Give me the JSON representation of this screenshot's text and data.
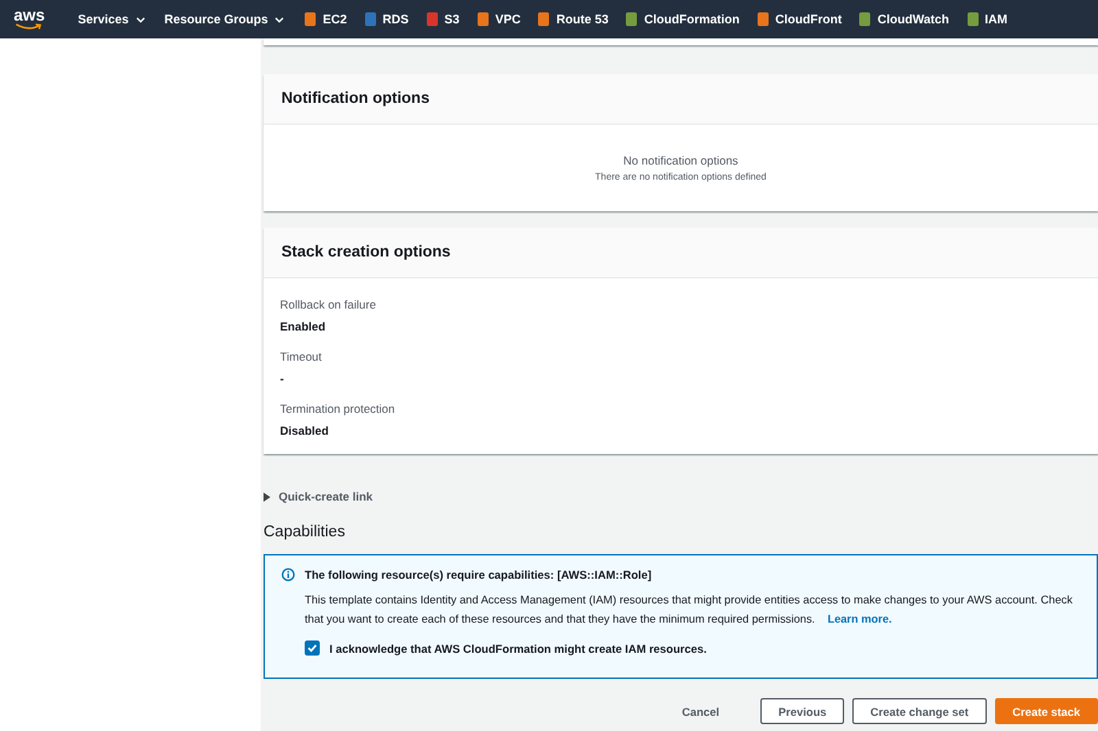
{
  "nav": {
    "logo": "aws",
    "menus": [
      "Services",
      "Resource Groups"
    ],
    "services": [
      {
        "label": "EC2",
        "color": "#e8741c"
      },
      {
        "label": "RDS",
        "color": "#2e73b8"
      },
      {
        "label": "S3",
        "color": "#d9352b"
      },
      {
        "label": "VPC",
        "color": "#e8741c"
      },
      {
        "label": "Route 53",
        "color": "#e8741c"
      },
      {
        "label": "CloudFormation",
        "color": "#759c3e"
      },
      {
        "label": "CloudFront",
        "color": "#e8741c"
      },
      {
        "label": "CloudWatch",
        "color": "#759c3e"
      },
      {
        "label": "IAM",
        "color": "#759c3e"
      }
    ]
  },
  "notification": {
    "title": "Notification options",
    "empty_title": "No notification options",
    "empty_text": "There are no notification options defined"
  },
  "stack_options": {
    "title": "Stack creation options",
    "fields": [
      {
        "label": "Rollback on failure",
        "value": "Enabled"
      },
      {
        "label": "Timeout",
        "value": "-"
      },
      {
        "label": "Termination protection",
        "value": "Disabled"
      }
    ]
  },
  "quick_create": {
    "label": "Quick-create link",
    "expanded": false
  },
  "capabilities": {
    "title": "Capabilities",
    "alert_title": "The following resource(s) require capabilities: [AWS::IAM::Role]",
    "alert_text": "This template contains Identity and Access Management (IAM) resources that might provide entities access to make changes to your AWS account. Check that you want to create each of these resources and that they have the minimum required permissions.",
    "link": "Learn more.",
    "ack": {
      "label": "I acknowledge that AWS CloudFormation might create IAM resources.",
      "checked": true
    }
  },
  "buttons": [
    {
      "label": "Cancel",
      "kind": "link"
    },
    {
      "label": "Previous",
      "kind": "outline"
    },
    {
      "label": "Create change set",
      "kind": "outline"
    },
    {
      "label": "Create stack",
      "kind": "primary"
    }
  ]
}
